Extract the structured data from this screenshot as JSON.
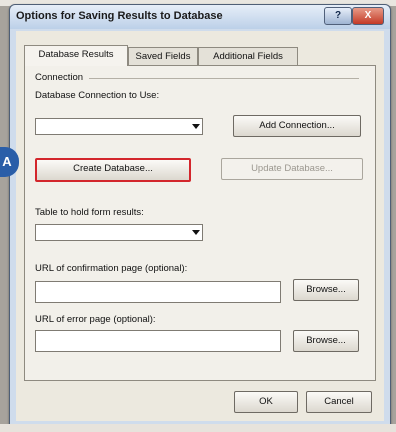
{
  "window": {
    "title": "Options for Saving Results to Database",
    "help_label": "?",
    "close_label": "X"
  },
  "tabs": [
    {
      "label": "Database Results",
      "active": true
    },
    {
      "label": "Saved Fields",
      "active": false
    },
    {
      "label": "Additional Fields",
      "active": false
    }
  ],
  "connection": {
    "group_label": "Connection",
    "db_label": "Database Connection to Use:",
    "db_value": "",
    "add_connection": "Add Connection...",
    "create_database": "Create Database...",
    "update_database": "Update Database..."
  },
  "table": {
    "label": "Table to hold form results:",
    "value": ""
  },
  "confirm_url": {
    "label": "URL of confirmation page (optional):",
    "value": "",
    "browse": "Browse..."
  },
  "error_url": {
    "label": "URL of error page (optional):",
    "value": "",
    "browse": "Browse..."
  },
  "footer": {
    "ok": "OK",
    "cancel": "Cancel"
  },
  "annotation": {
    "marker": "A",
    "highlight_color": "#d3262c",
    "marker_color": "#2a5ea8"
  }
}
